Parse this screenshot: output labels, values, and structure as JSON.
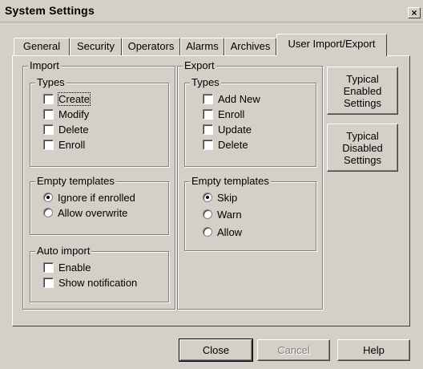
{
  "window": {
    "title": "System Settings",
    "close_glyph": "×"
  },
  "tabs": [
    {
      "label": "General"
    },
    {
      "label": "Security"
    },
    {
      "label": "Operators"
    },
    {
      "label": "Alarms"
    },
    {
      "label": "Archives"
    },
    {
      "label": "User Import/Export",
      "active": true
    }
  ],
  "import": {
    "label": "Import",
    "types": {
      "label": "Types",
      "items": [
        {
          "label": "Create",
          "checked": false
        },
        {
          "label": "Modify",
          "checked": false
        },
        {
          "label": "Delete",
          "checked": false
        },
        {
          "label": "Enroll",
          "checked": false
        }
      ]
    },
    "empty_templates": {
      "label": "Empty templates",
      "options": [
        {
          "label": "Ignore if enrolled",
          "selected": true
        },
        {
          "label": "Allow overwrite",
          "selected": false
        }
      ]
    },
    "auto_import": {
      "label": "Auto import",
      "items": [
        {
          "label": "Enable",
          "checked": false
        },
        {
          "label": "Show notification",
          "checked": false
        }
      ]
    }
  },
  "export": {
    "label": "Export",
    "types": {
      "label": "Types",
      "items": [
        {
          "label": "Add New",
          "checked": false
        },
        {
          "label": "Enroll",
          "checked": false
        },
        {
          "label": "Update",
          "checked": false
        },
        {
          "label": "Delete",
          "checked": false
        }
      ]
    },
    "empty_templates": {
      "label": "Empty templates",
      "options": [
        {
          "label": "Skip",
          "selected": true
        },
        {
          "label": "Warn",
          "selected": false
        },
        {
          "label": "Allow",
          "selected": false
        }
      ]
    }
  },
  "side_buttons": {
    "enabled": "Typical Enabled Settings",
    "disabled": "Typical Disabled Settings"
  },
  "footer": {
    "close": "Close",
    "cancel": "Cancel",
    "help": "Help"
  }
}
